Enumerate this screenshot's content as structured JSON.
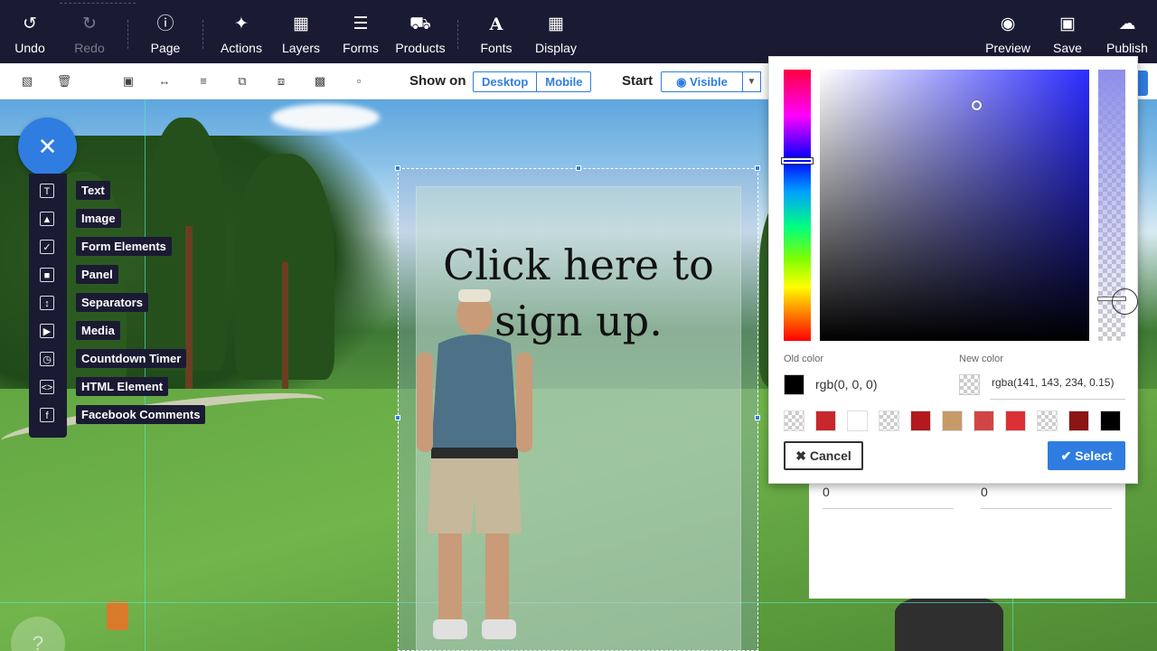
{
  "toolbar": {
    "undo": "Undo",
    "redo": "Redo",
    "page": "Page",
    "actions": "Actions",
    "layers": "Layers",
    "forms": "Forms",
    "products": "Products",
    "fonts": "Fonts",
    "display": "Display",
    "preview": "Preview",
    "save": "Save",
    "publish": "Publish"
  },
  "subbar": {
    "show_on_label": "Show on",
    "desktop": "Desktop",
    "mobile": "Mobile",
    "start_label": "Start",
    "visible": "Visible"
  },
  "canvas": {
    "popup_title_line1": "Click here to",
    "popup_title_line2": "sign up."
  },
  "add_menu": {
    "items": [
      {
        "label": "Text",
        "icon": "text-icon"
      },
      {
        "label": "Image",
        "icon": "image-icon"
      },
      {
        "label": "Form Elements",
        "icon": "form-elements-icon"
      },
      {
        "label": "Panel",
        "icon": "panel-icon"
      },
      {
        "label": "Separators",
        "icon": "separators-icon"
      },
      {
        "label": "Media",
        "icon": "media-icon"
      },
      {
        "label": "Countdown Timer",
        "icon": "timer-icon"
      },
      {
        "label": "HTML Element",
        "icon": "code-icon"
      },
      {
        "label": "Facebook Comments",
        "icon": "facebook-icon"
      }
    ]
  },
  "settings": {
    "field_left_value": "0",
    "field_right_value": "0"
  },
  "color_picker": {
    "old_color_label": "Old color",
    "old_color_value": "rgb(0, 0, 0)",
    "new_color_label": "New color",
    "new_color_value": "rgba(141, 143, 234, 0.15)",
    "cancel": "Cancel",
    "select": "Select",
    "presets": [
      "transparent",
      "#c8282d",
      "#ffffff",
      "transparent",
      "#b3191e",
      "#c79a6a",
      "#d24546",
      "#dc3036",
      "transparent",
      "#8c1515",
      "#000000"
    ],
    "accent": "#2f7de1"
  }
}
